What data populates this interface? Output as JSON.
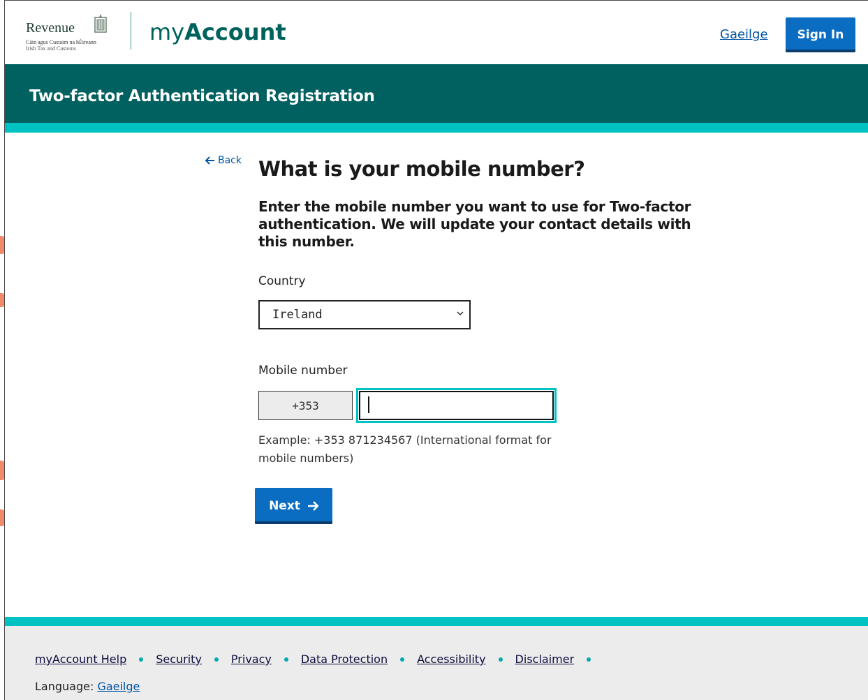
{
  "header": {
    "logo_word": "Revenue",
    "logo_sub1": "Cáin agus Custaim na hÉireann",
    "logo_sub2": "Irish Tax and Customs",
    "brand_my": "my",
    "brand_account": "Account",
    "language_link": "Gaeilge",
    "signin_label": "Sign In"
  },
  "banner": {
    "title": "Two-factor Authentication Registration"
  },
  "main": {
    "back_label": "Back",
    "title": "What is your mobile number?",
    "lead": "Enter the mobile number you want to use for Two-factor authentication. We will update your contact details with this number.",
    "country_label": "Country",
    "country_value": "Ireland",
    "mobile_label": "Mobile number",
    "prefix": "+353",
    "mobile_value": "",
    "hint": "Example: +353 871234567 (International format for mobile numbers)",
    "next_label": "Next"
  },
  "footer": {
    "links": [
      "myAccount Help",
      "Security",
      "Privacy",
      "Data Protection",
      "Accessibility",
      "Disclaimer"
    ],
    "language_prefix": "Language: ",
    "language_link": "Gaeilge"
  },
  "colors": {
    "teal_dark": "#016060",
    "teal_bright": "#00c2c2",
    "button_blue": "#0a6dc2",
    "link_blue": "#0055a5"
  },
  "icons": {
    "back": "arrow-left-icon",
    "next": "arrow-right-icon",
    "select": "chevron-down-icon",
    "logo": "harp-icon"
  }
}
